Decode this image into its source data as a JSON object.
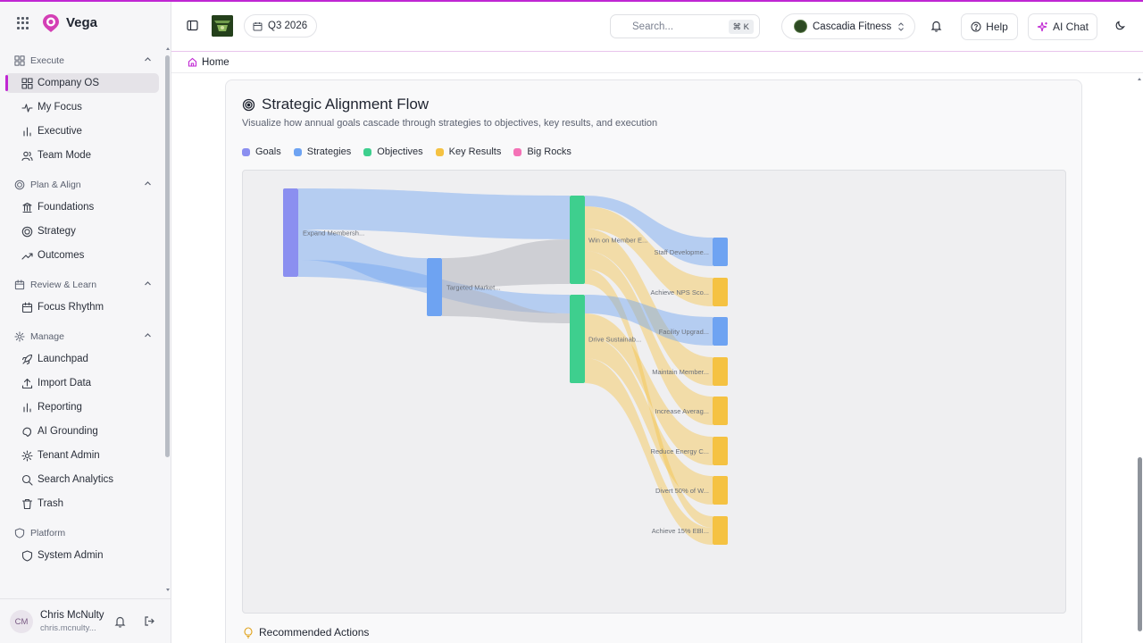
{
  "app": {
    "name": "Vega"
  },
  "sidebar": {
    "sections": [
      {
        "label": "Execute",
        "items": [
          "Company OS",
          "My Focus",
          "Executive",
          "Team Mode"
        ]
      },
      {
        "label": "Plan & Align",
        "items": [
          "Foundations",
          "Strategy",
          "Outcomes"
        ]
      },
      {
        "label": "Review & Learn",
        "items": [
          "Focus Rhythm"
        ]
      },
      {
        "label": "Manage",
        "items": [
          "Launchpad",
          "Import Data",
          "Reporting",
          "AI Grounding",
          "Tenant Admin",
          "Search Analytics",
          "Trash"
        ]
      },
      {
        "label": "Platform",
        "items": [
          "System Admin"
        ]
      }
    ],
    "active_item": "Company OS",
    "user": {
      "initials": "CM",
      "name": "Chris McNulty",
      "email": "chris.mcnulty..."
    }
  },
  "header": {
    "quarter": "Q3 2026",
    "search_placeholder": "Search...",
    "search_shortcut": "⌘ K",
    "tenant": "Cascadia Fitness",
    "help_label": "Help",
    "ai_chat_label": "AI Chat"
  },
  "breadcrumb": {
    "home": "Home"
  },
  "main": {
    "title": "Strategic Alignment Flow",
    "subtitle": "Visualize how annual goals cascade through strategies to objectives, key results, and execution",
    "legend": [
      {
        "label": "Goals",
        "color": "#8b8ff0"
      },
      {
        "label": "Strategies",
        "color": "#6ea3f2"
      },
      {
        "label": "Objectives",
        "color": "#3ecf8e"
      },
      {
        "label": "Key Results",
        "color": "#f5c242"
      },
      {
        "label": "Big Rocks",
        "color": "#f472b6"
      }
    ],
    "recommended_actions": "Recommended Actions"
  },
  "flow_nodes": [
    {
      "label": "Expand Membersh...",
      "type": "Goals"
    },
    {
      "label": "Targeted Market...",
      "type": "Strategies"
    },
    {
      "label": "Win on Member E...",
      "type": "Objectives"
    },
    {
      "label": "Drive Sustainab...",
      "type": "Objectives"
    },
    {
      "label": "Staff Developme...",
      "type": "Strategies"
    },
    {
      "label": "Achieve NPS Sco...",
      "type": "Key Results"
    },
    {
      "label": "Facility Upgrad...",
      "type": "Strategies"
    },
    {
      "label": "Maintain Member...",
      "type": "Key Results"
    },
    {
      "label": "Increase Averag...",
      "type": "Key Results"
    },
    {
      "label": "Reduce Energy C...",
      "type": "Key Results"
    },
    {
      "label": "Divert 50% of W...",
      "type": "Key Results"
    },
    {
      "label": "Achieve 15% EBI...",
      "type": "Key Results"
    }
  ]
}
